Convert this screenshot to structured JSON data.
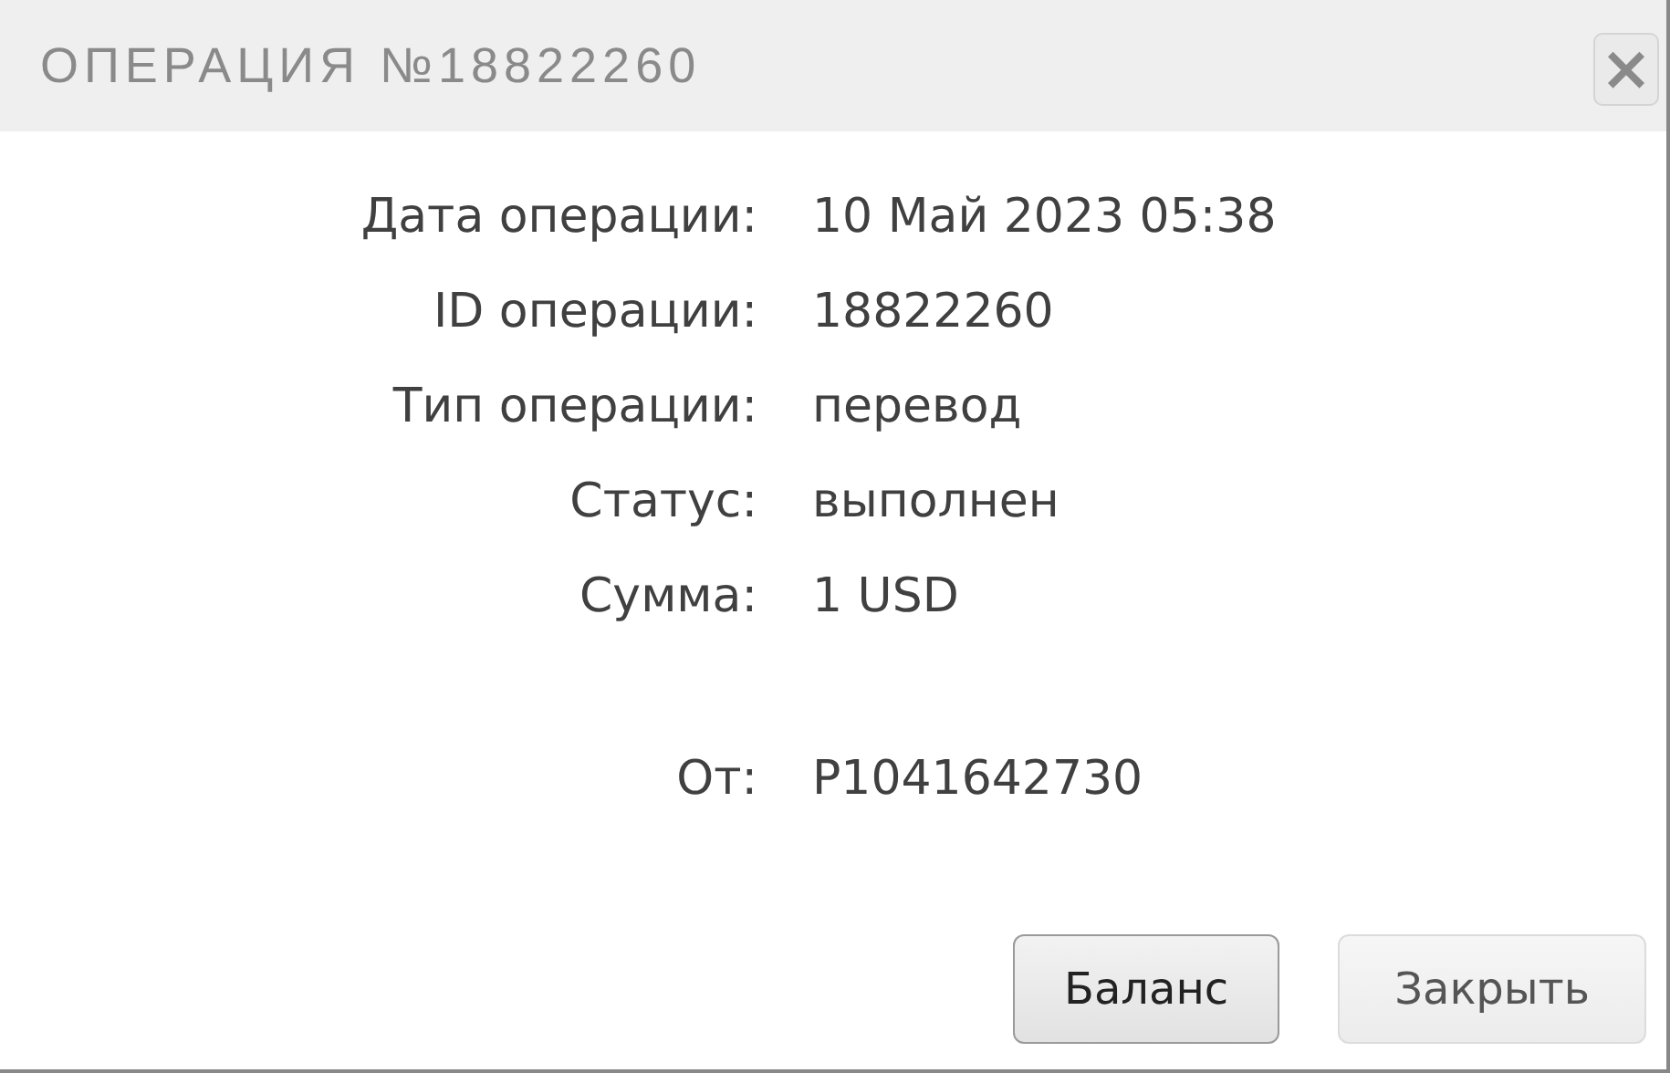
{
  "dialog": {
    "title": "ОПЕРАЦИЯ №18822260",
    "close_label": "×"
  },
  "details": [
    {
      "label": "Дата операции:",
      "value": "10 Май 2023 05:38"
    },
    {
      "label": "ID операции:",
      "value": "18822260"
    },
    {
      "label": "Тип операции:",
      "value": "перевод"
    },
    {
      "label": "Статус:",
      "value": "выполнен"
    },
    {
      "label": "Сумма:",
      "value": "1 USD"
    }
  ],
  "source": {
    "label": "От:",
    "value": "P1041642730"
  },
  "buttons": [
    {
      "label": "Баланс",
      "emphasized": true
    },
    {
      "label": "Закрыть",
      "emphasized": false
    }
  ]
}
